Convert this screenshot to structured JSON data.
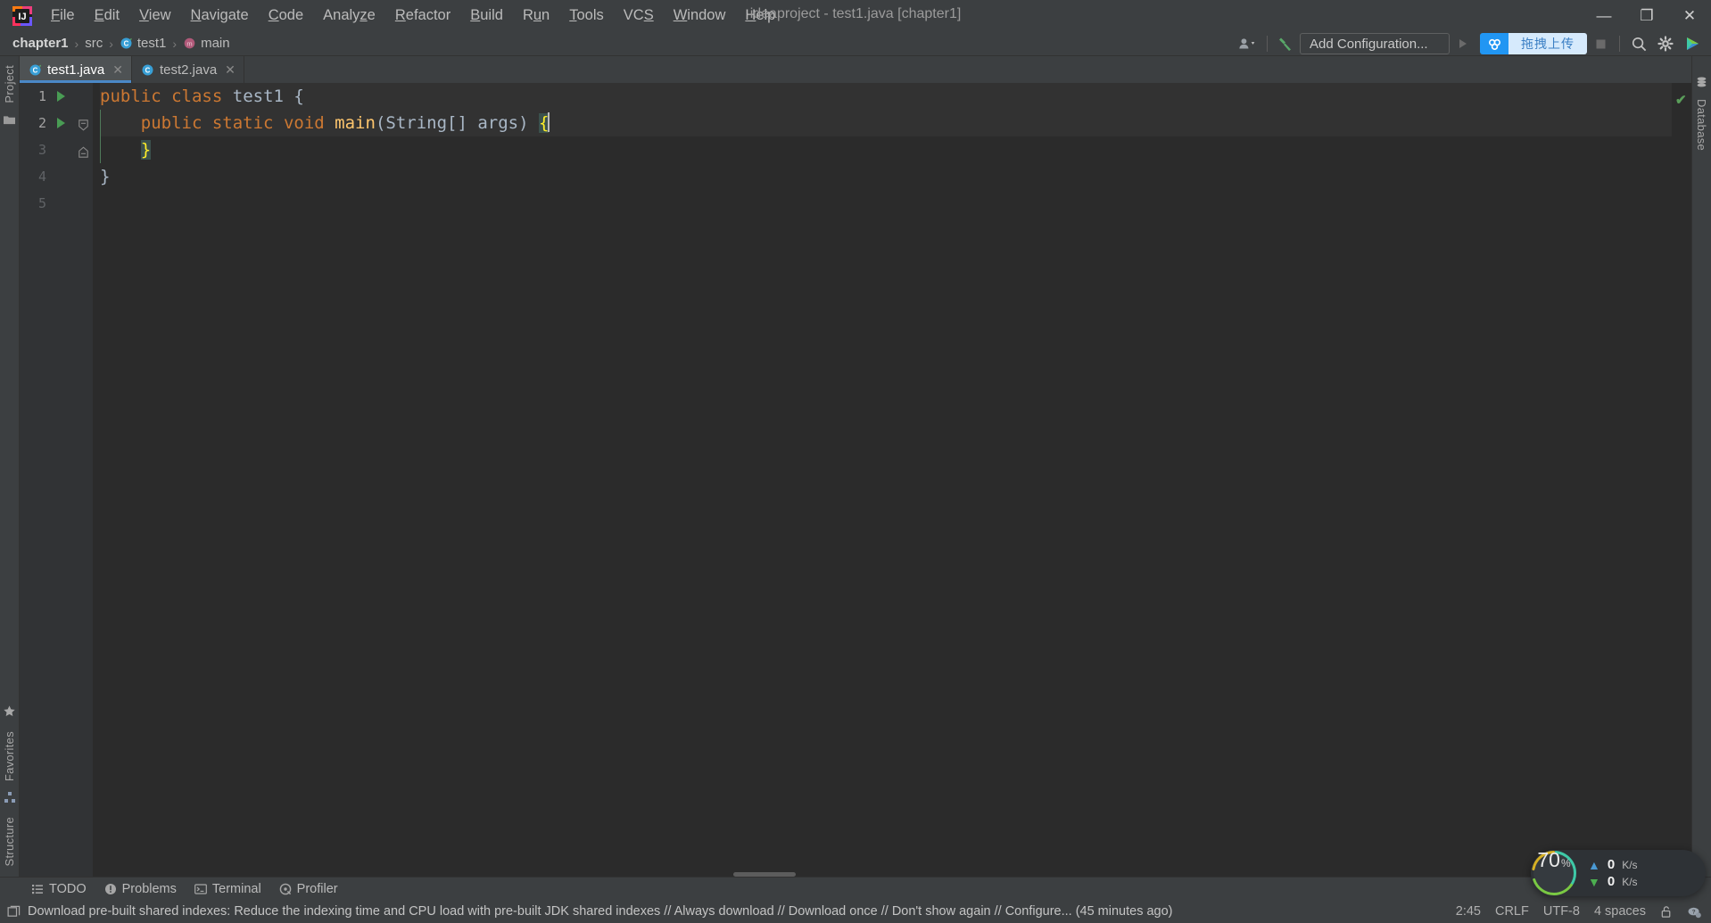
{
  "window": {
    "title": "ideaproject - test1.java [chapter1]",
    "minimize_label": "—",
    "maximize_label": "❐",
    "close_label": "✕"
  },
  "menubar": {
    "logo_name": "intellij-idea-logo",
    "items": [
      {
        "label": "File",
        "mnemonic": "F"
      },
      {
        "label": "Edit",
        "mnemonic": "E"
      },
      {
        "label": "View",
        "mnemonic": "V"
      },
      {
        "label": "Navigate",
        "mnemonic": "N"
      },
      {
        "label": "Code",
        "mnemonic": "C"
      },
      {
        "label": "Analyze",
        "mnemonic": "z"
      },
      {
        "label": "Refactor",
        "mnemonic": "R"
      },
      {
        "label": "Build",
        "mnemonic": "B"
      },
      {
        "label": "Run",
        "mnemonic": "u"
      },
      {
        "label": "Tools",
        "mnemonic": "T"
      },
      {
        "label": "VCS",
        "mnemonic": "S"
      },
      {
        "label": "Window",
        "mnemonic": "W"
      },
      {
        "label": "Help",
        "mnemonic": "H"
      }
    ]
  },
  "navbar": {
    "breadcrumbs": [
      {
        "label": "chapter1",
        "icon": "project-icon"
      },
      {
        "label": "src",
        "icon": "folder-icon"
      },
      {
        "label": "test1",
        "icon": "java-class-icon"
      },
      {
        "label": "main",
        "icon": "method-icon"
      }
    ],
    "separator": "›",
    "run_configuration_label": "Add Configuration...",
    "upload_widget_label": "拖拽上传",
    "accent_blue": "#2196f3",
    "upload_text_color": "#3b7fc4"
  },
  "left_strip": {
    "top_label": "Project",
    "bottom_labels": [
      "Structure",
      "Favorites"
    ]
  },
  "right_strip": {
    "label": "Database"
  },
  "editor": {
    "tabs": [
      {
        "label": "test1.java",
        "active": true,
        "icon": "java-runnable-class-icon",
        "close": "✕"
      },
      {
        "label": "test2.java",
        "active": false,
        "icon": "java-class-icon",
        "close": "✕"
      }
    ],
    "lines": [
      {
        "num": "1",
        "runnable": true,
        "caret_line": true,
        "fold": "none",
        "tokens": [
          {
            "t": "public",
            "c": "kw"
          },
          {
            "t": " ",
            "c": "plain"
          },
          {
            "t": "class",
            "c": "kw"
          },
          {
            "t": " ",
            "c": "plain"
          },
          {
            "t": "test1",
            "c": "cls"
          },
          {
            "t": " ",
            "c": "plain"
          },
          {
            "t": "{",
            "c": "brace"
          }
        ],
        "indent": 0
      },
      {
        "num": "2",
        "runnable": true,
        "caret_line": true,
        "fold": "open",
        "tokens": [
          {
            "t": "    ",
            "c": "plain"
          },
          {
            "t": "public",
            "c": "kw"
          },
          {
            "t": " ",
            "c": "plain"
          },
          {
            "t": "static",
            "c": "kw"
          },
          {
            "t": " ",
            "c": "plain"
          },
          {
            "t": "void",
            "c": "kw"
          },
          {
            "t": " ",
            "c": "plain"
          },
          {
            "t": "main",
            "c": "mth"
          },
          {
            "t": "(",
            "c": "brace"
          },
          {
            "t": "String[] args",
            "c": "cls"
          },
          {
            "t": ")",
            "c": "brace"
          },
          {
            "t": " ",
            "c": "plain"
          },
          {
            "t": "{",
            "c": "brace-hl"
          }
        ],
        "indent": 1,
        "caret_after": true
      },
      {
        "num": "3",
        "runnable": false,
        "caret_line": false,
        "fold": "close",
        "tokens": [
          {
            "t": "    ",
            "c": "plain"
          },
          {
            "t": "}",
            "c": "brace-hl"
          }
        ],
        "indent": 1
      },
      {
        "num": "4",
        "runnable": false,
        "caret_line": false,
        "fold": "none",
        "tokens": [
          {
            "t": "}",
            "c": "brace"
          }
        ],
        "indent": 0
      },
      {
        "num": "5",
        "runnable": false,
        "caret_line": false,
        "fold": "none",
        "tokens": [],
        "indent": 0
      }
    ],
    "inspection_status": "✔",
    "inspection_status_name": "no-problems-check"
  },
  "tool_windows": [
    {
      "label": "TODO",
      "icon": "todo-list-icon"
    },
    {
      "label": "Problems",
      "icon": "problems-warning-icon"
    },
    {
      "label": "Terminal",
      "icon": "terminal-icon"
    },
    {
      "label": "Profiler",
      "icon": "profiler-icon"
    }
  ],
  "statusbar": {
    "message": "Download pre-built shared indexes: Reduce the indexing time and CPU load with pre-built JDK shared indexes // Always download // Download once // Don't show again // Configure... (45 minutes ago)",
    "caret_position": "2:45",
    "line_separator": "CRLF",
    "encoding": "UTF-8",
    "indent": "4 spaces",
    "lock_icon": "unlocked-padlock-icon",
    "help_icon": "help-cloud-icon"
  },
  "network_monitor": {
    "percent_value": "70",
    "percent_symbol": "%",
    "upload_speed": "0",
    "upload_unit": "K/s",
    "download_speed": "0",
    "download_unit": "K/s",
    "ring_colors": {
      "teal": "#3ec9a7",
      "green": "#7ac943",
      "yellow": "#d6b024"
    }
  }
}
